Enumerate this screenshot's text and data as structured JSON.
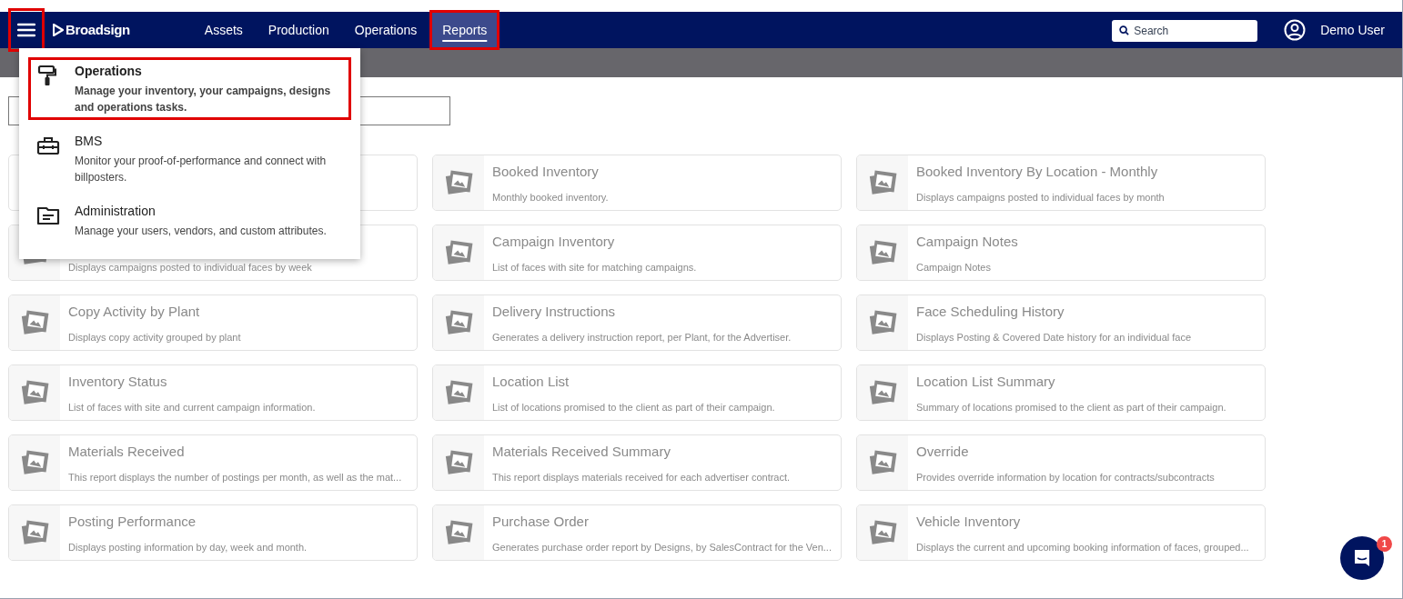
{
  "header": {
    "menu_button": {
      "highlighted": true
    },
    "logo": "Broadsign",
    "nav": [
      {
        "label": "Assets",
        "selected": false,
        "highlighted": false
      },
      {
        "label": "Production",
        "selected": false,
        "highlighted": false
      },
      {
        "label": "Operations",
        "selected": false,
        "highlighted": false
      },
      {
        "label": "Reports",
        "selected": true,
        "highlighted": true
      }
    ],
    "search": {
      "placeholder": "Search"
    },
    "user": "Demo User"
  },
  "app_menu": {
    "expanded": true,
    "items": [
      {
        "kind": "roller",
        "title": "Operations",
        "description": "Manage your inventory, your campaigns, designs and operations tasks.",
        "selected": true,
        "highlighted": true
      },
      {
        "kind": "toolbox",
        "title": "BMS",
        "description": "Monitor your proof-of-performance and connect with billposters.",
        "selected": false,
        "highlighted": false
      },
      {
        "kind": "folder",
        "title": "Administration",
        "description": "Manage your users, vendors, and custom attributes.",
        "selected": false,
        "highlighted": false
      }
    ]
  },
  "report_rows": [
    {
      "cards": [
        {
          "kind": "covered"
        },
        {
          "title": "Booked Inventory",
          "description": "Monthly booked inventory."
        },
        {
          "title": "Booked Inventory By Location - Monthly",
          "description": "Displays campaigns posted to individual faces by month"
        }
      ]
    },
    {
      "cards": [
        {
          "description": "Displays campaigns posted to individual faces by week"
        },
        {
          "title": "Campaign Inventory",
          "description": "List of faces with site for matching campaigns."
        },
        {
          "title": "Campaign Notes",
          "description": "Campaign Notes"
        }
      ]
    },
    {
      "cards": [
        {
          "title": "Copy Activity by Plant",
          "description": "Displays copy activity grouped by plant"
        },
        {
          "title": "Delivery Instructions",
          "description": "Generates a delivery instruction report, per Plant, for the Advertiser."
        },
        {
          "title": "Face Scheduling History",
          "description": "Displays Posting & Covered Date history for an individual face"
        }
      ]
    },
    {
      "cards": [
        {
          "title": "Inventory Status",
          "description": "List of faces with site and current campaign information."
        },
        {
          "title": "Location List",
          "description": "List of locations promised to the client as part of their campaign."
        },
        {
          "title": "Location List Summary",
          "description": "Summary of locations promised to the client as part of their campaign."
        }
      ]
    },
    {
      "cards": [
        {
          "title": "Materials Received",
          "description": "This report displays the number of postings per month, as well as the mat..."
        },
        {
          "title": "Materials Received Summary",
          "description": "This report displays materials received for each advertiser contract."
        },
        {
          "title": "Override",
          "description": "Provides override information by location for contracts/subcontracts"
        }
      ]
    },
    {
      "cards": [
        {
          "title": "Posting Performance",
          "description": "Displays posting information by day, week and month."
        },
        {
          "title": "Purchase Order",
          "description": "Generates purchase order report by Designs, by SalesContract for the Ven..."
        },
        {
          "title": "Vehicle Inventory",
          "description": "Displays the current and upcoming booking information of faces, grouped..."
        }
      ]
    }
  ],
  "chat": {
    "badge": "1"
  }
}
